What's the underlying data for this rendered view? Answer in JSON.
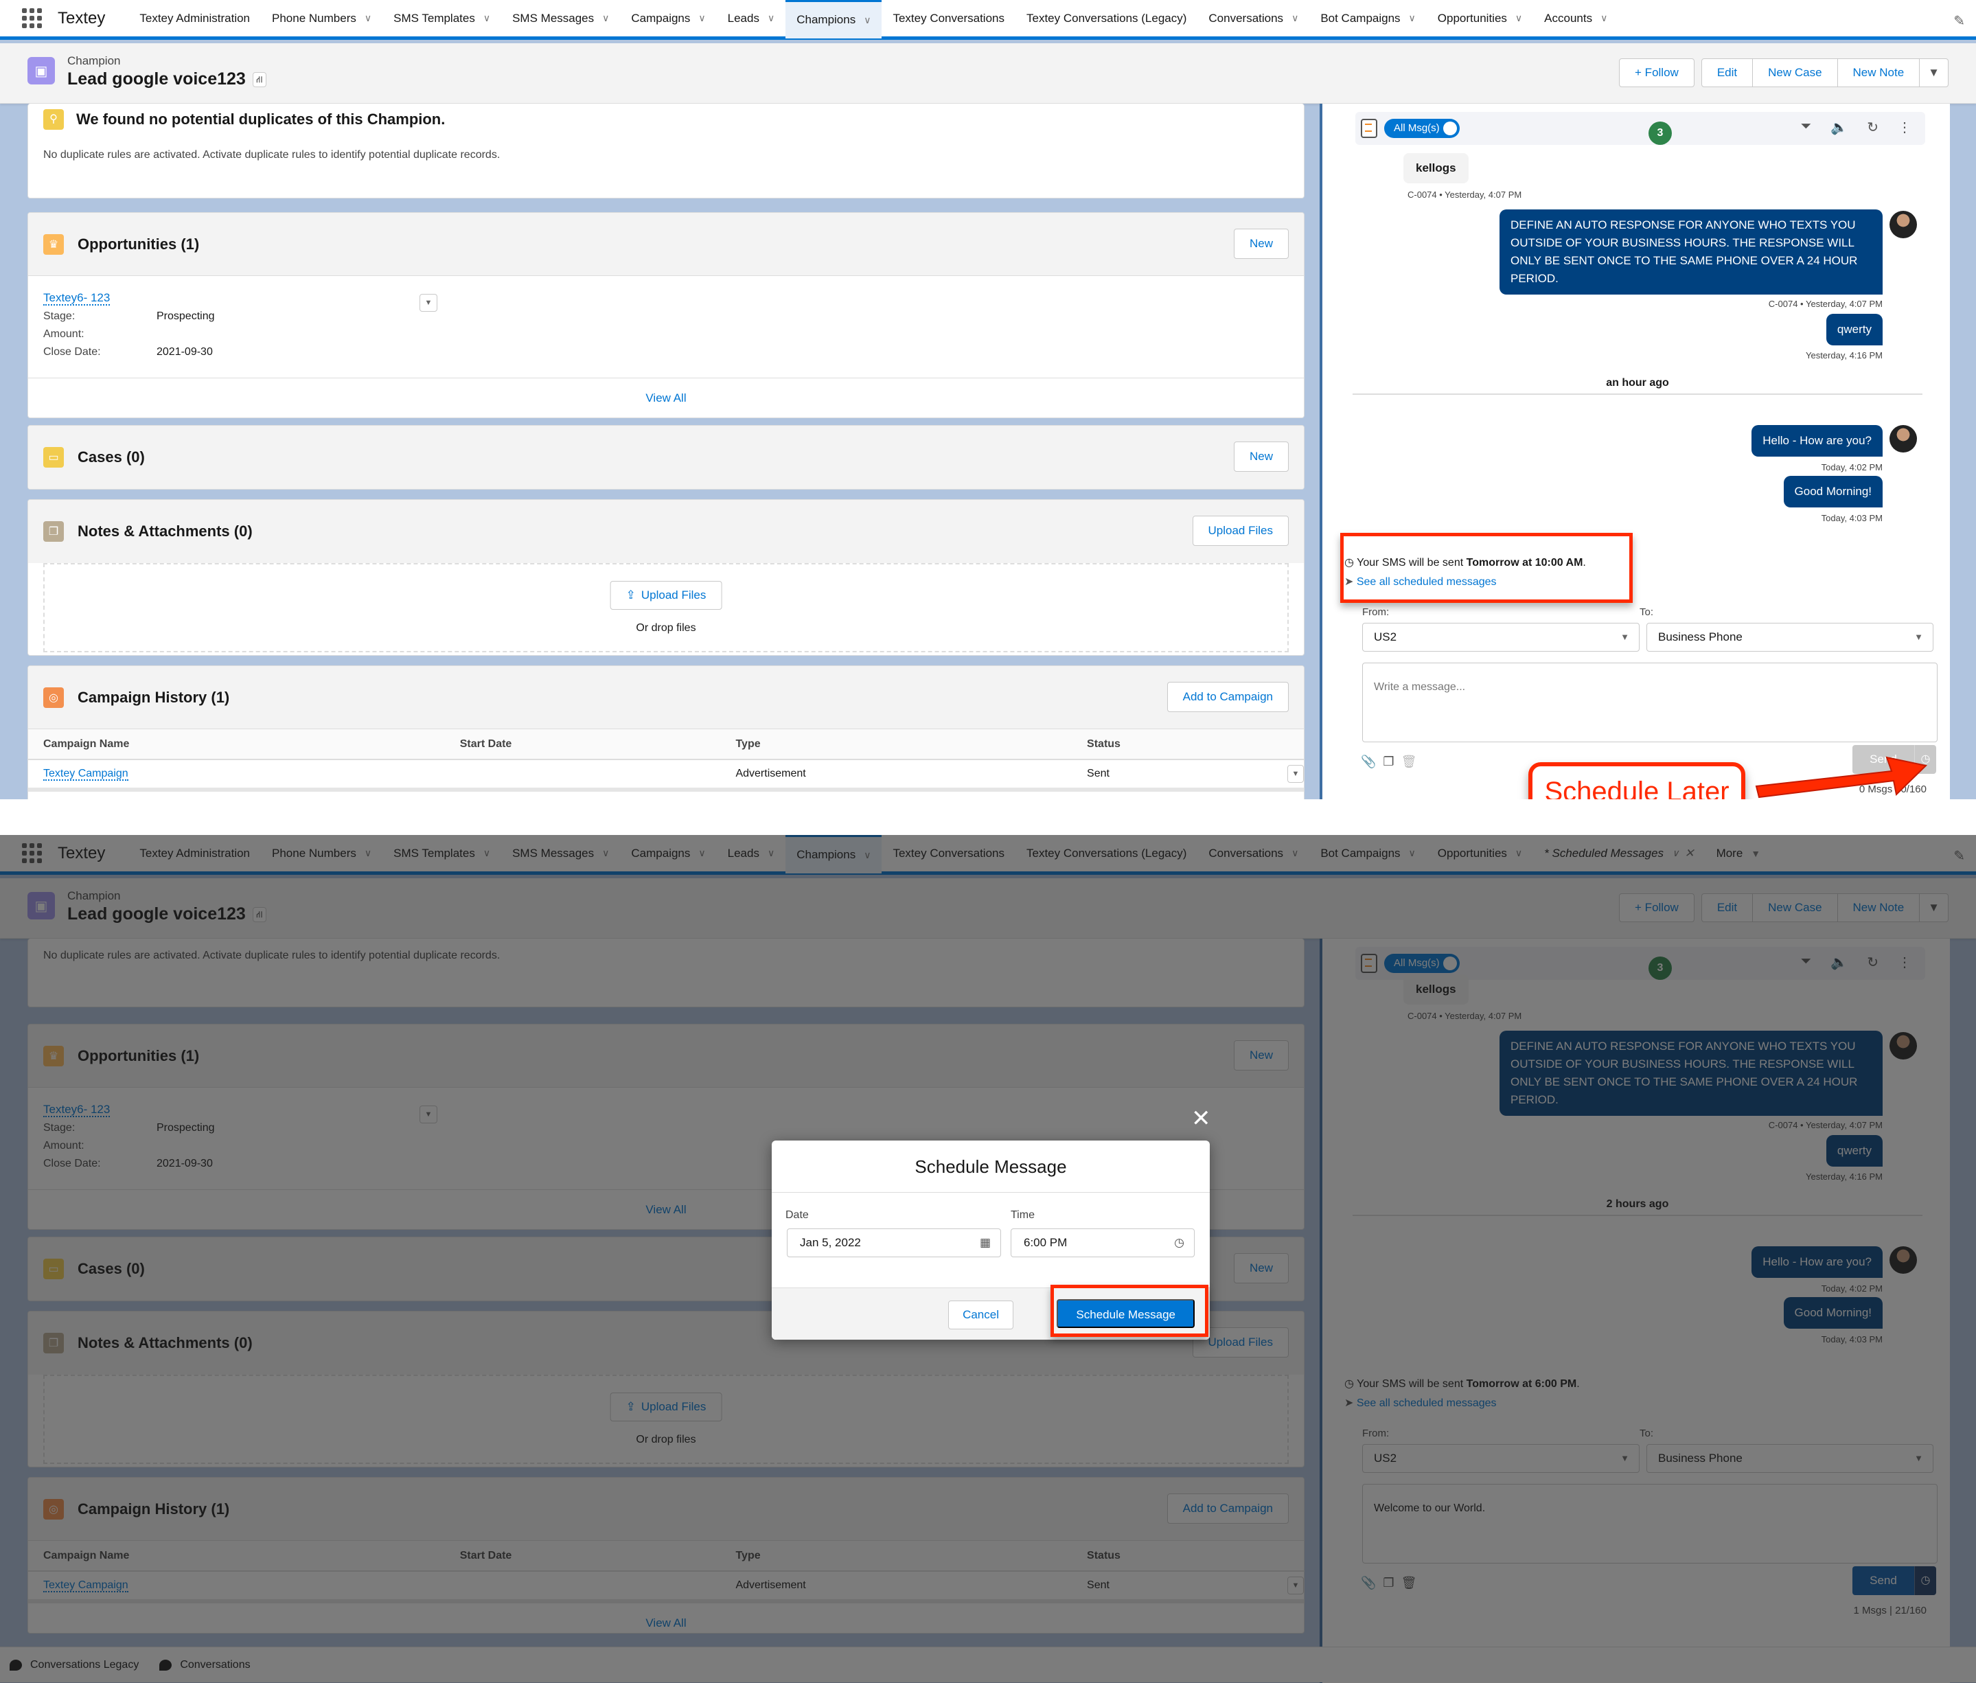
{
  "nav": {
    "app_name": "Textey",
    "tabs_top": [
      {
        "label": "Textey Administration",
        "has_menu": false
      },
      {
        "label": "Phone Numbers",
        "has_menu": true
      },
      {
        "label": "SMS Templates",
        "has_menu": true
      },
      {
        "label": "SMS Messages",
        "has_menu": true
      },
      {
        "label": "Campaigns",
        "has_menu": true
      },
      {
        "label": "Leads",
        "has_menu": true
      },
      {
        "label": "Champions",
        "has_menu": true,
        "active": true
      },
      {
        "label": "Textey Conversations",
        "has_menu": false
      },
      {
        "label": "Textey Conversations (Legacy)",
        "has_menu": false
      },
      {
        "label": "Conversations",
        "has_menu": true
      },
      {
        "label": "Bot Campaigns",
        "has_menu": true
      },
      {
        "label": "Opportunities",
        "has_menu": true
      },
      {
        "label": "Accounts",
        "has_menu": true
      }
    ],
    "tabs_bottom_extra": {
      "scheduled_tab": "* Scheduled Messages",
      "more": "More"
    }
  },
  "record": {
    "type": "Champion",
    "title": "Lead google voice123",
    "actions": {
      "follow": "+ Follow",
      "edit": "Edit",
      "new_case": "New Case",
      "new_note": "New Note"
    }
  },
  "duplicates": {
    "title": "We found no potential duplicates of this Champion.",
    "subtitle": "No duplicate rules are activated. Activate duplicate rules to identify potential duplicate records."
  },
  "opportunities": {
    "title": "Opportunities (1)",
    "new_label": "New",
    "record_name": "Textey6- 123",
    "fields": [
      {
        "label": "Stage:",
        "value": "Prospecting"
      },
      {
        "label": "Amount:",
        "value": ""
      },
      {
        "label": "Close Date:",
        "value": "2021-09-30"
      }
    ],
    "view_all": "View All"
  },
  "cases": {
    "title": "Cases (0)",
    "new_label": "New"
  },
  "notes": {
    "title": "Notes & Attachments (0)",
    "upload_label": "Upload Files",
    "drop_text": "Or drop files"
  },
  "campaign_history": {
    "title": "Campaign History (1)",
    "add_label": "Add to Campaign",
    "columns": [
      "Campaign Name",
      "Start Date",
      "Type",
      "Status"
    ],
    "rows": [
      {
        "name": "Textey Campaign",
        "start_date": "",
        "type": "Advertisement",
        "status": "Sent"
      }
    ],
    "view_all": "View All"
  },
  "chat": {
    "filter_toggle": "All Msg(s)",
    "unread_count": "3",
    "messages": [
      {
        "direction": "in",
        "text": "kellogs",
        "meta": "C-0074 • Yesterday, 4:07 PM"
      },
      {
        "direction": "out",
        "text": "DEFINE AN AUTO RESPONSE FOR ANYONE WHO TEXTS YOU OUTSIDE OF YOUR BUSINESS HOURS. THE RESPONSE WILL ONLY BE SENT ONCE TO THE SAME PHONE OVER A 24 HOUR PERIOD.",
        "meta": "C-0074 • Yesterday, 4:07 PM"
      },
      {
        "direction": "out",
        "text": "qwerty",
        "meta": "Yesterday, 4:16 PM"
      },
      {
        "direction": "out",
        "text": "Hello - How are you?",
        "meta": "Today, 4:02 PM"
      },
      {
        "direction": "out",
        "text": "Good Morning!",
        "meta": "Today, 4:03 PM"
      }
    ],
    "from_label": "From:",
    "to_label": "To:",
    "from_value": "US2",
    "to_value": "Business Phone",
    "see_all": "See all scheduled messages",
    "send_label": "Send",
    "sms_prefix": "Your SMS will be sent ",
    "placeholder": "Write a message..."
  },
  "state_before": {
    "time_divider": "an hour ago",
    "scheduled_when": "Tomorrow at 10:00 AM",
    "message_value": "",
    "counter": "0 Msgs | 0/160"
  },
  "state_after": {
    "time_divider": "2 hours ago",
    "scheduled_when": "Tomorrow at 6:00 PM",
    "message_value": "Welcome to our World.",
    "counter": "1 Msgs | 21/160"
  },
  "utility_bar": [
    "Conversations Legacy",
    "Conversations"
  ],
  "annotation": {
    "callout": "Schedule Later"
  },
  "modal": {
    "title": "Schedule Message",
    "date_label": "Date",
    "date_value": "Jan 5, 2022",
    "time_label": "Time",
    "time_value": "6:00 PM",
    "cancel": "Cancel",
    "submit": "Schedule Message"
  },
  "colors": {
    "brand": "#0176d3",
    "bubble_out": "#00417f",
    "annotation_red": "#ff2a00",
    "badge_green": "#2e844a"
  }
}
